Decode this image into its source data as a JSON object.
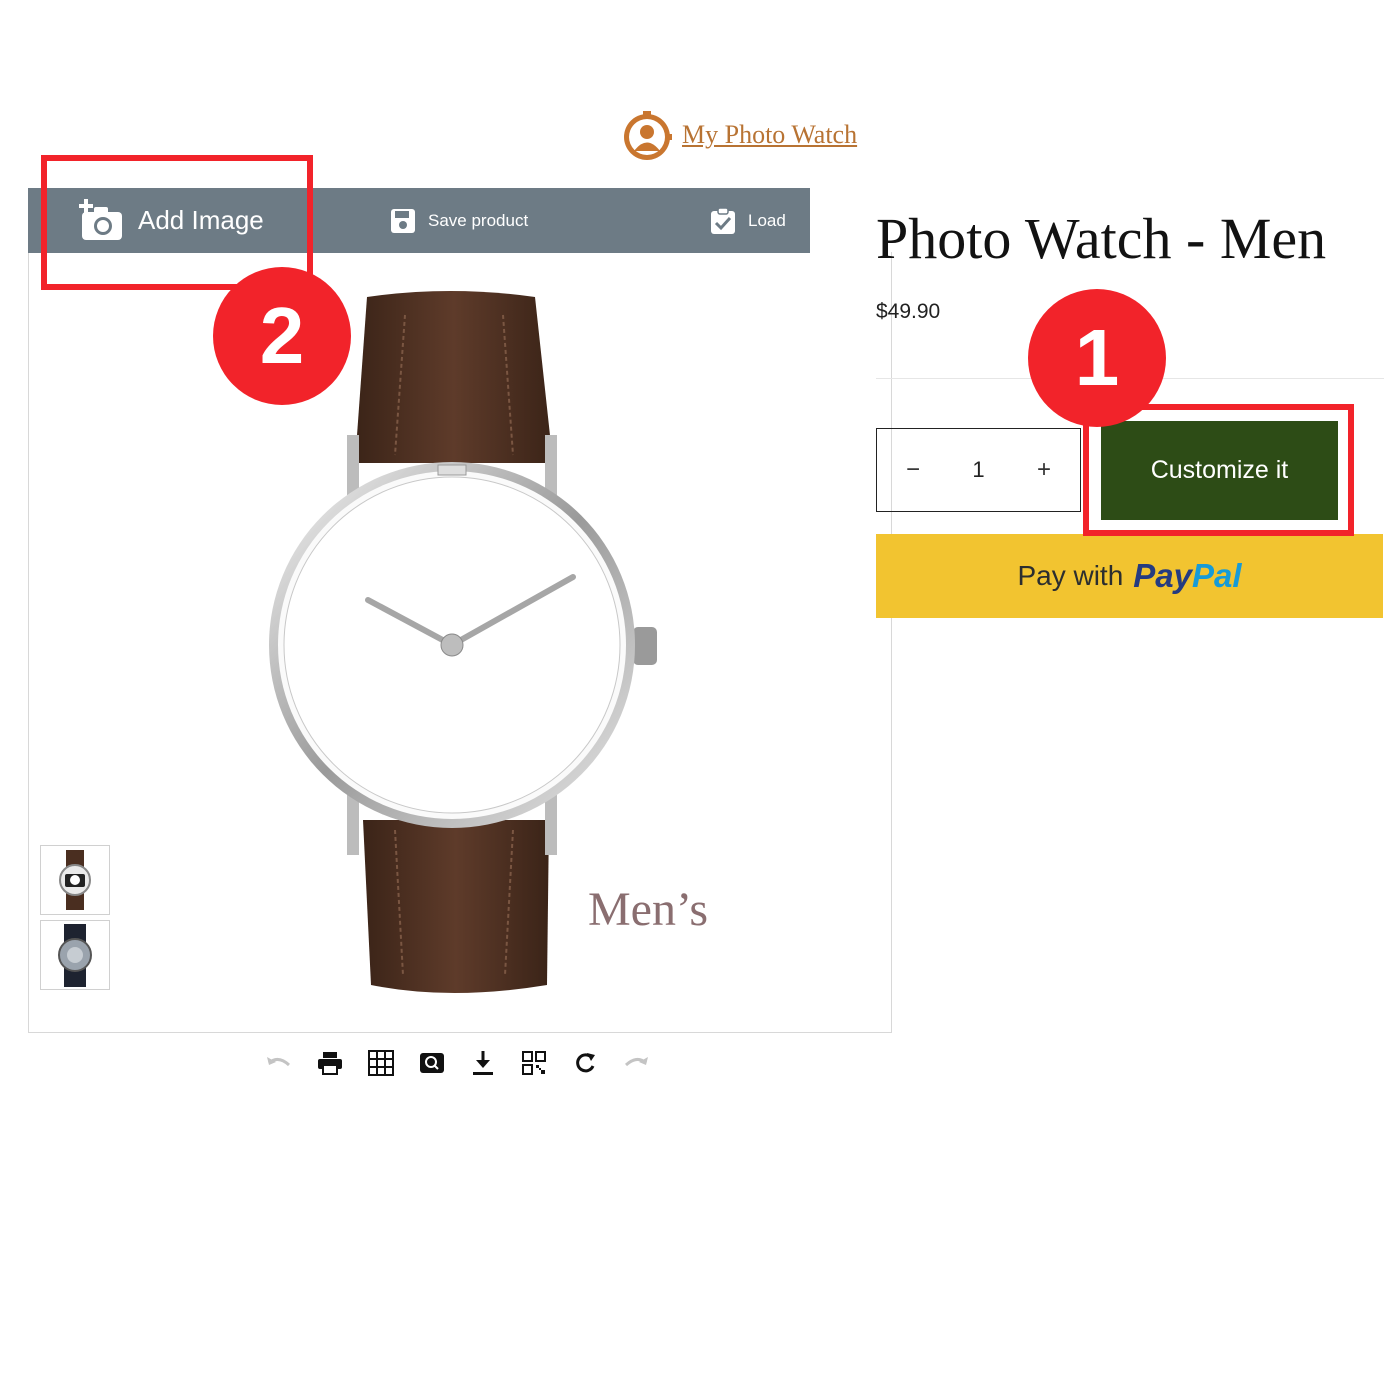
{
  "brand": {
    "name": "My Photo Watch",
    "logo_icon": "person-clock-icon"
  },
  "designer": {
    "toolbar": {
      "add_image": "Add Image",
      "save_product": "Save product",
      "load": "Load"
    },
    "watch_label": "Men’s",
    "thumbnails": [
      "watch-front-thumbnail",
      "watch-back-thumbnail"
    ],
    "tools": [
      "undo-icon",
      "print-icon",
      "grid-icon",
      "zoom-icon",
      "download-icon",
      "qr-code-icon",
      "refresh-icon",
      "redo-icon"
    ]
  },
  "product": {
    "title": "Photo Watch - Men",
    "price": "$49.90",
    "quantity": "1",
    "qty_minus": "−",
    "qty_plus": "+",
    "customize_label": "Customize it",
    "paypal": {
      "prefix": "Pay with",
      "brand_a": "Pay",
      "brand_b": "Pal"
    }
  },
  "annotations": {
    "step1": "1",
    "step2": "2"
  },
  "colors": {
    "toolbar_bg": "#6d7b85",
    "customize_bg": "#2d4c16",
    "paypal_bg": "#f2c430",
    "brand": "#b87333",
    "annotation": "#f2232a"
  }
}
